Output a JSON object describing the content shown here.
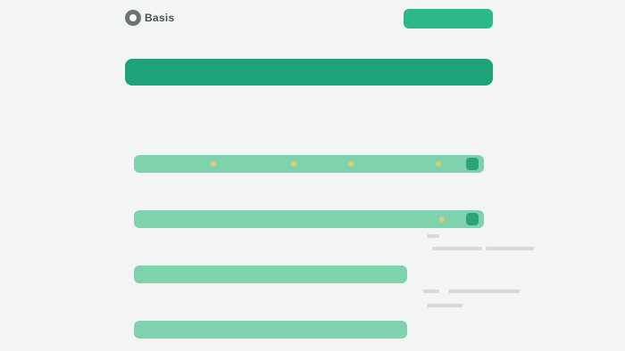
{
  "header": {
    "logo_text": "Basis",
    "cta_label": ""
  },
  "banner": {
    "title": ""
  },
  "meta": {
    "top_note": "",
    "bottom_note": ""
  },
  "rows": [
    {
      "label": "",
      "progress": 1.0,
      "markers": 4
    },
    {
      "label": "",
      "progress": 1.0,
      "markers": 1
    },
    {
      "label": "",
      "progress": 0.78,
      "markers": 0
    },
    {
      "label": "",
      "progress": 0.78,
      "markers": 0
    }
  ],
  "colors": {
    "accent": "#1ea27a",
    "track": "#c4e8d9",
    "fill": "#7fd2ae",
    "marker": "#e6c76a"
  },
  "icons": {
    "logo": "logo-icon"
  }
}
